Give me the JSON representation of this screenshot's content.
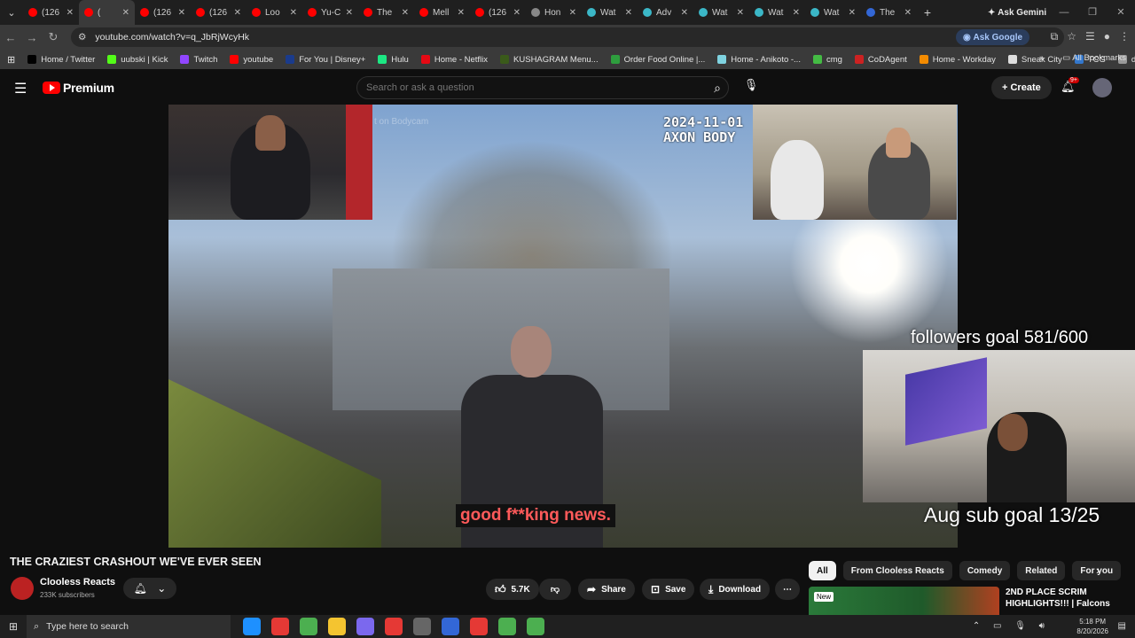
{
  "browser": {
    "tabs": [
      {
        "label": "(126",
        "color": "#ff0000"
      },
      {
        "label": "(",
        "color": "#ff0000",
        "active": true
      },
      {
        "label": "(126",
        "color": "#ff0000"
      },
      {
        "label": "(126",
        "color": "#ff0000"
      },
      {
        "label": "Loo",
        "color": "#ff0000"
      },
      {
        "label": "Yu-C",
        "color": "#ff0000"
      },
      {
        "label": "The",
        "color": "#ff0000"
      },
      {
        "label": "Mell",
        "color": "#ff0000"
      },
      {
        "label": "(126",
        "color": "#ff0000"
      },
      {
        "label": "Hon",
        "color": "#888888"
      },
      {
        "label": "Wat",
        "color": "#3bb7c7"
      },
      {
        "label": "Adv",
        "color": "#3bb7c7"
      },
      {
        "label": "Wat",
        "color": "#3bb7c7"
      },
      {
        "label": "Wat",
        "color": "#3bb7c7"
      },
      {
        "label": "Wat",
        "color": "#3bb7c7"
      },
      {
        "label": "The",
        "color": "#3367d6"
      }
    ],
    "ask_gemini": "Ask Gemini",
    "url": "youtube.com/watch?v=q_JbRjWcyHk",
    "ask_google": "Ask Google",
    "bookmarks": [
      {
        "label": "Home / Twitter",
        "color": "#000000"
      },
      {
        "label": "uubski | Kick",
        "color": "#53fc18"
      },
      {
        "label": "Twitch",
        "color": "#9146ff"
      },
      {
        "label": "youtube",
        "color": "#ff0000"
      },
      {
        "label": "For You | Disney+",
        "color": "#1a3b8c"
      },
      {
        "label": "Hulu",
        "color": "#1ce783"
      },
      {
        "label": "Home - Netflix",
        "color": "#e50914"
      },
      {
        "label": "KUSHAGRAM Menu...",
        "color": "#3a5a1a"
      },
      {
        "label": "Order Food Online |...",
        "color": "#2e9e3e"
      },
      {
        "label": "Home - Anikoto -...",
        "color": "#7fd3e0"
      },
      {
        "label": "cmg",
        "color": "#44bb44"
      },
      {
        "label": "CoDAgent",
        "color": "#cc2222"
      },
      {
        "label": "Home - Workday",
        "color": "#f38b00"
      },
      {
        "label": "Sneak City",
        "color": "#dddddd"
      },
      {
        "label": "TCG",
        "color": "#3377cc"
      },
      {
        "label": "dubby",
        "color": "#999999"
      }
    ],
    "all_bookmarks": "All Bookmarks"
  },
  "youtube": {
    "logo_text": "Premium",
    "search_placeholder": "Search or ask a question",
    "create_label": "Create",
    "notif_badge": "9+"
  },
  "video": {
    "watermark": "t on Bodycam",
    "cam_date": "2024-11-01",
    "cam_label": "AXON BODY",
    "caption": "good f**king news.",
    "followers_goal": "followers goal 581/600",
    "sub_goal": "Aug sub goal 13/25"
  },
  "meta": {
    "title": "THE CRAZIEST CRASHOUT WE'VE EVER SEEN",
    "channel": "Clooless Reacts",
    "subscribers": "233K subscribers",
    "likes": "5.7K",
    "share_label": "Share",
    "save_label": "Save",
    "download_label": "Download"
  },
  "chips": [
    "All",
    "From Clooless Reacts",
    "Comedy",
    "Related",
    "For you"
  ],
  "recommendation": {
    "badge": "New",
    "title": "2ND PLACE SCRIM HIGHLIGHTS!!! | Falcons"
  },
  "taskbar": {
    "search_placeholder": "Type here to search",
    "time": "5:18 PM",
    "date": "8/20/2026",
    "apps": [
      "#1e90ff",
      "#e53935",
      "#4caf50",
      "#f4c430",
      "#7b68ee",
      "#e53935",
      "#666666",
      "#3367d6",
      "#e53935",
      "#4caf50",
      "#4caf50"
    ]
  }
}
